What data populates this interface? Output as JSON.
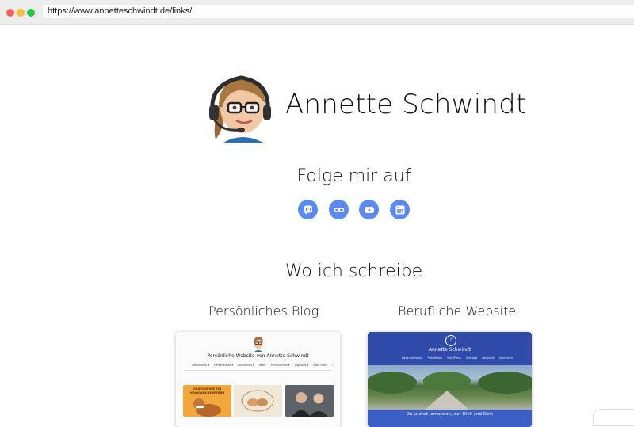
{
  "browser": {
    "url": "https://www.annetteschwindt.de/links/"
  },
  "profile": {
    "name": "Annette Schwindt",
    "avatar_icon": "avatar-headset-icon"
  },
  "follow": {
    "title": "Folge mir auf",
    "links": [
      {
        "name": "mastodon-icon",
        "color": "#5b8bf0"
      },
      {
        "name": "link-icon",
        "color": "#5b8bf0"
      },
      {
        "name": "youtube-icon",
        "color": "#5b8bf0"
      },
      {
        "name": "linkedin-icon",
        "color": "#5b8bf0"
      }
    ]
  },
  "writing": {
    "title": "Wo ich schreibe",
    "blog": {
      "label": "Persönliches Blog",
      "preview_title": "Persönliche Website von Annette Schwindt",
      "preview_nav": [
        "Gesundheit ▾",
        "Persönliches ▾",
        "Kulturelles ▾",
        "Texte",
        "Persönliches ▾",
        "Digitales ▾",
        "Über mich",
        "⌕"
      ],
      "thumb1_text": "GRINSEN WIE EIN HONIGKUCHENPFERD"
    },
    "work": {
      "label": "Berufliche Website",
      "preview_title": "Annette Schwindt",
      "preview_nav": [
        "Kommunikation",
        "Publikation",
        "WordPress",
        "Vorträge",
        "Beispiele",
        "Über mich"
      ],
      "preview_banner": "Du suchst jemanden, der Dich und Dein"
    }
  }
}
